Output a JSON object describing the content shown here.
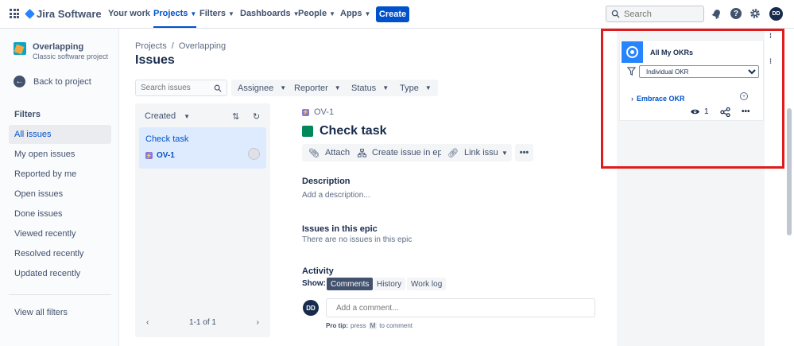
{
  "topnav": {
    "logo_text": "Jira Software",
    "items": [
      {
        "label": "Your work",
        "caret": false
      },
      {
        "label": "Projects",
        "caret": true,
        "active": true
      },
      {
        "label": "Filters",
        "caret": true
      },
      {
        "label": "Dashboards",
        "caret": true
      },
      {
        "label": "People",
        "caret": true
      },
      {
        "label": "Apps",
        "caret": true
      }
    ],
    "create_label": "Create",
    "search_placeholder": "Search",
    "avatar_initials": "DD"
  },
  "sidebar": {
    "project_name": "Overlapping",
    "project_type": "Classic software project",
    "back_label": "Back to project",
    "filters_title": "Filters",
    "filters": [
      {
        "label": "All issues",
        "active": true
      },
      {
        "label": "My open issues"
      },
      {
        "label": "Reported by me"
      },
      {
        "label": "Open issues"
      },
      {
        "label": "Done issues"
      },
      {
        "label": "Viewed recently"
      },
      {
        "label": "Resolved recently"
      },
      {
        "label": "Updated recently"
      }
    ],
    "view_all": "View all filters"
  },
  "main": {
    "breadcrumb": [
      "Projects",
      "/",
      "Overlapping"
    ],
    "title": "Issues",
    "search_placeholder": "Search issues",
    "dropdowns": [
      "Assignee",
      "Reporter",
      "Status",
      "Type"
    ]
  },
  "issue_list": {
    "sort_label": "Created",
    "issues": [
      {
        "title": "Check task",
        "key": "OV-1"
      }
    ],
    "pager": "1-1 of 1"
  },
  "detail": {
    "key": "OV-1",
    "title": "Check task",
    "actions": [
      "Attach",
      "Create issue in epic",
      "Link issue"
    ],
    "description_title": "Description",
    "description_placeholder": "Add a description...",
    "epic_title": "Issues in this epic",
    "epic_empty": "There are no issues in this epic",
    "activity_title": "Activity",
    "show_label": "Show:",
    "tabs": [
      "Comments",
      "History",
      "Work log"
    ],
    "comment_avatar": "DD",
    "comment_placeholder": "Add a comment...",
    "pro_tip_prefix": "Pro tip:",
    "pro_tip_press": "press",
    "pro_tip_key": "M",
    "pro_tip_suffix": "to comment"
  },
  "okr_panel": {
    "title": "All My OKRs",
    "filter_value": "Individual OKR",
    "item": "Embrace OKR",
    "watchers": "1",
    "highlight_color": "#e01b1b"
  },
  "colors": {
    "brand": "#0052cc",
    "status_done": "#00875a",
    "okr_logo": "#2684ff"
  }
}
